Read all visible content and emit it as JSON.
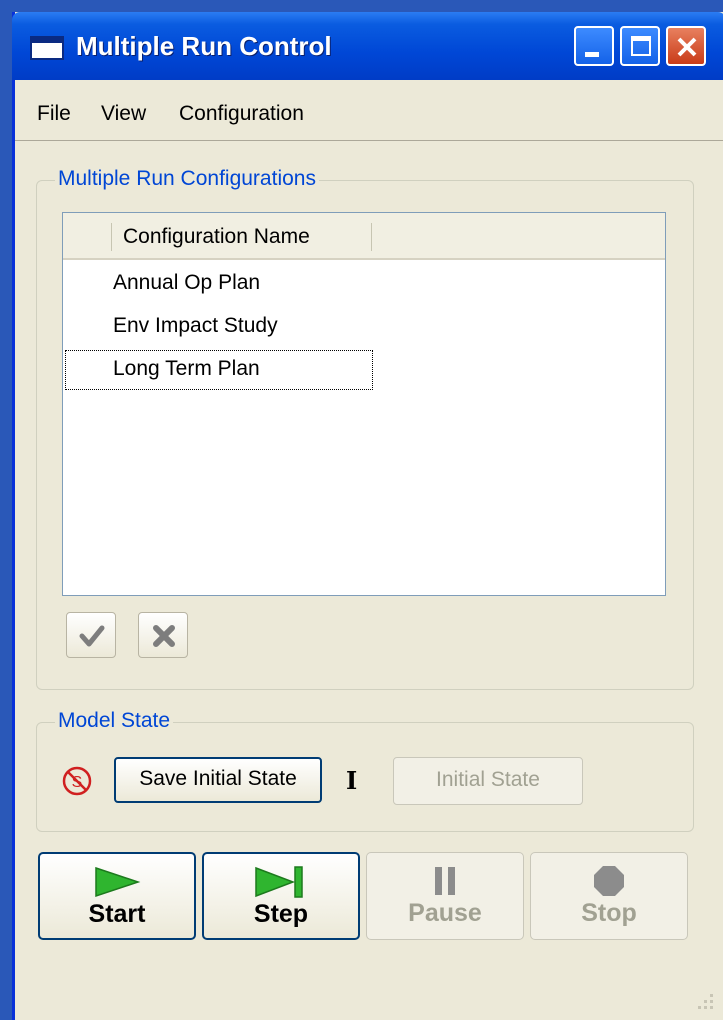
{
  "window": {
    "title": "Multiple Run Control"
  },
  "menu": {
    "file": "File",
    "view": "View",
    "configuration": "Configuration"
  },
  "configurations": {
    "group_label": "Multiple Run Configurations",
    "column_header": "Configuration Name",
    "items": [
      "Annual Op Plan",
      "Env Impact Study",
      "Long Term Plan"
    ],
    "focused_index": 2
  },
  "model_state": {
    "group_label": "Model State",
    "save_button": "Save Initial State",
    "initial_state_button": "Initial State"
  },
  "run_buttons": {
    "start": "Start",
    "step": "Step",
    "pause": "Pause",
    "stop": "Stop"
  },
  "colors": {
    "desktop": "#2a58b8",
    "titlebar": "#0047d6",
    "group_label": "#0046d5",
    "play_green": "#2fb52f",
    "disabled_text": "#a1a192"
  }
}
